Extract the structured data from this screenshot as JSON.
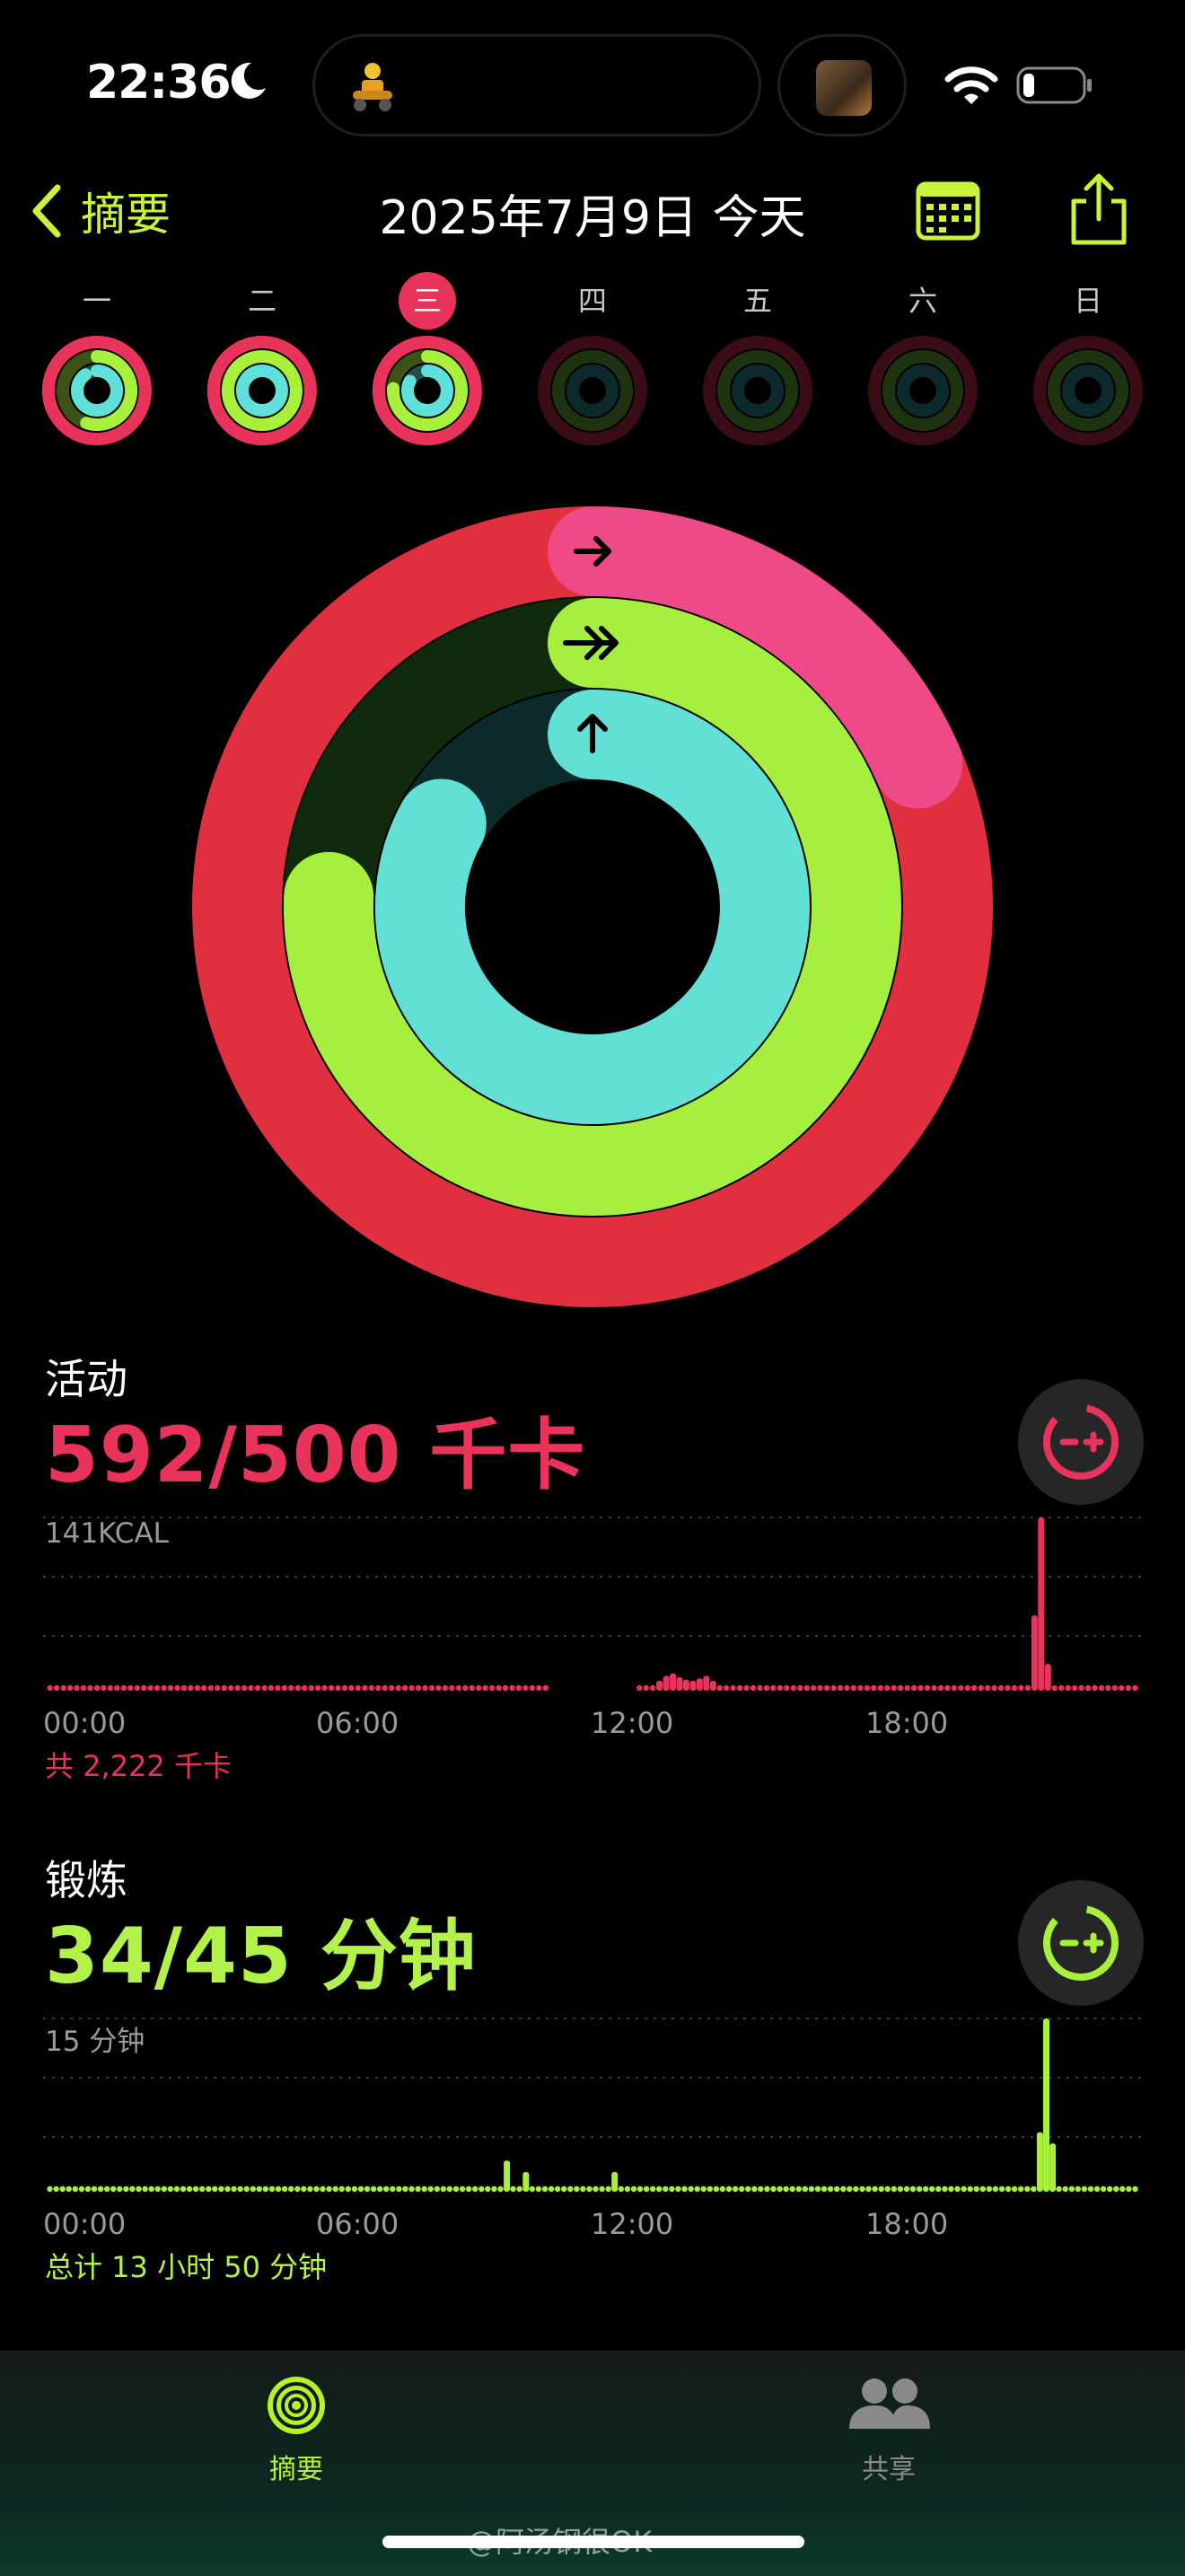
{
  "status_bar": {
    "time": "22:36"
  },
  "nav": {
    "back_label": "摘要",
    "title": "2025年7月9日 今天"
  },
  "week": {
    "days": [
      "一",
      "二",
      "三",
      "四",
      "五",
      "六",
      "日"
    ],
    "today_index": 2
  },
  "rings": {
    "move_fraction": 1.184,
    "exercise_fraction": 0.756,
    "stand_fraction": 0.83
  },
  "colors": {
    "move": "#e8335a",
    "exercise": "#a8f03c",
    "stand": "#5fe0d8"
  },
  "activity": {
    "title": "活动",
    "value": "592/500 千卡",
    "chart_max_label": "141KCAL",
    "total": "共 2,222 千卡"
  },
  "exercise": {
    "title": "锻炼",
    "value": "34/45 分钟",
    "chart_max_label": "15 分钟",
    "total": "总计 13 小时 50 分钟"
  },
  "chart_ticks": [
    "00:00",
    "06:00",
    "12:00",
    "18:00"
  ],
  "chart_data": [
    {
      "type": "bar",
      "title": "活动",
      "ylabel": "141KCAL",
      "ylim": [
        0,
        141
      ],
      "x": [
        "00:00",
        "06:00",
        "12:00",
        "18:00"
      ],
      "series": [
        {
          "values": [
            2,
            2,
            2,
            2,
            2,
            2,
            2,
            2,
            2,
            2,
            2,
            2,
            2,
            2,
            2,
            2,
            2,
            2,
            2,
            2,
            2,
            2,
            2,
            2,
            2,
            2,
            2,
            2,
            2,
            2,
            2,
            2,
            2,
            2,
            2,
            2,
            2,
            2,
            2,
            2,
            2,
            2,
            2,
            2,
            2,
            2,
            2,
            2,
            2,
            2,
            2,
            2,
            2,
            2,
            2,
            2,
            2,
            2,
            2,
            2,
            2,
            2,
            2,
            2,
            2,
            2,
            2,
            2,
            2,
            2,
            2,
            2,
            3,
            4,
            2,
            null,
            null,
            null,
            null,
            null,
            null,
            null,
            null,
            null,
            null,
            null,
            null,
            null,
            2,
            2,
            3,
            6,
            10,
            12,
            9,
            7,
            6,
            8,
            10,
            6,
            4,
            3,
            2,
            2,
            2,
            3,
            2,
            2,
            4,
            2,
            2,
            2,
            2,
            2,
            2,
            2,
            3,
            2,
            2,
            2,
            2,
            2,
            2,
            2,
            2,
            2,
            2,
            2,
            2,
            2,
            4,
            2,
            2,
            2,
            2,
            2,
            2,
            2,
            2,
            2,
            2,
            2,
            2,
            2,
            2,
            2,
            2,
            60,
            141,
            20,
            2,
            2,
            2,
            2,
            2,
            2,
            2,
            2,
            2,
            2,
            2,
            2,
            2
          ]
        }
      ]
    },
    {
      "type": "bar",
      "title": "锻炼",
      "ylabel": "15 分钟",
      "ylim": [
        0,
        15
      ],
      "x": [
        "00:00",
        "06:00",
        "12:00",
        "18:00"
      ],
      "series": [
        {
          "values": [
            0,
            0,
            0,
            0,
            0,
            0,
            0,
            0,
            0,
            0,
            0,
            0,
            0,
            0,
            0,
            0,
            0,
            0,
            0,
            0,
            0,
            0,
            0,
            0,
            0,
            0,
            0,
            0,
            0,
            0,
            0,
            0,
            0,
            0,
            0,
            0,
            0,
            0,
            0,
            0,
            0,
            0,
            0,
            0,
            0,
            0,
            0,
            0,
            0,
            0,
            0,
            0,
            0,
            0,
            0,
            0,
            0,
            0,
            0,
            0,
            0,
            0,
            0,
            0,
            0,
            0,
            0,
            0,
            0,
            0,
            0,
            0,
            2.5,
            0,
            0,
            1.5,
            0,
            0,
            0,
            0,
            0,
            0,
            0,
            0,
            0,
            0,
            0.5,
            0,
            0,
            1.5,
            0,
            0,
            0,
            0,
            0,
            0,
            0,
            0,
            0,
            0,
            0,
            0,
            0,
            0,
            0,
            0,
            0,
            0,
            0,
            0,
            0,
            0,
            0,
            0,
            0,
            0,
            0,
            0,
            0,
            0,
            0,
            0,
            0,
            0,
            0,
            0,
            0,
            0,
            0,
            0,
            0,
            0,
            0,
            0,
            0,
            0,
            0,
            0,
            0,
            0,
            0,
            0,
            0,
            0,
            0,
            0,
            0,
            0,
            0,
            0,
            0,
            0,
            0,
            0,
            0,
            0,
            5,
            15,
            4,
            0,
            0,
            0,
            0,
            0,
            0,
            0,
            0,
            0,
            0,
            0,
            0,
            0
          ]
        }
      ]
    }
  ],
  "tabbar": {
    "summary_label": "摘要",
    "share_label": "共享"
  },
  "watermark": "@阿汤钢很OK"
}
